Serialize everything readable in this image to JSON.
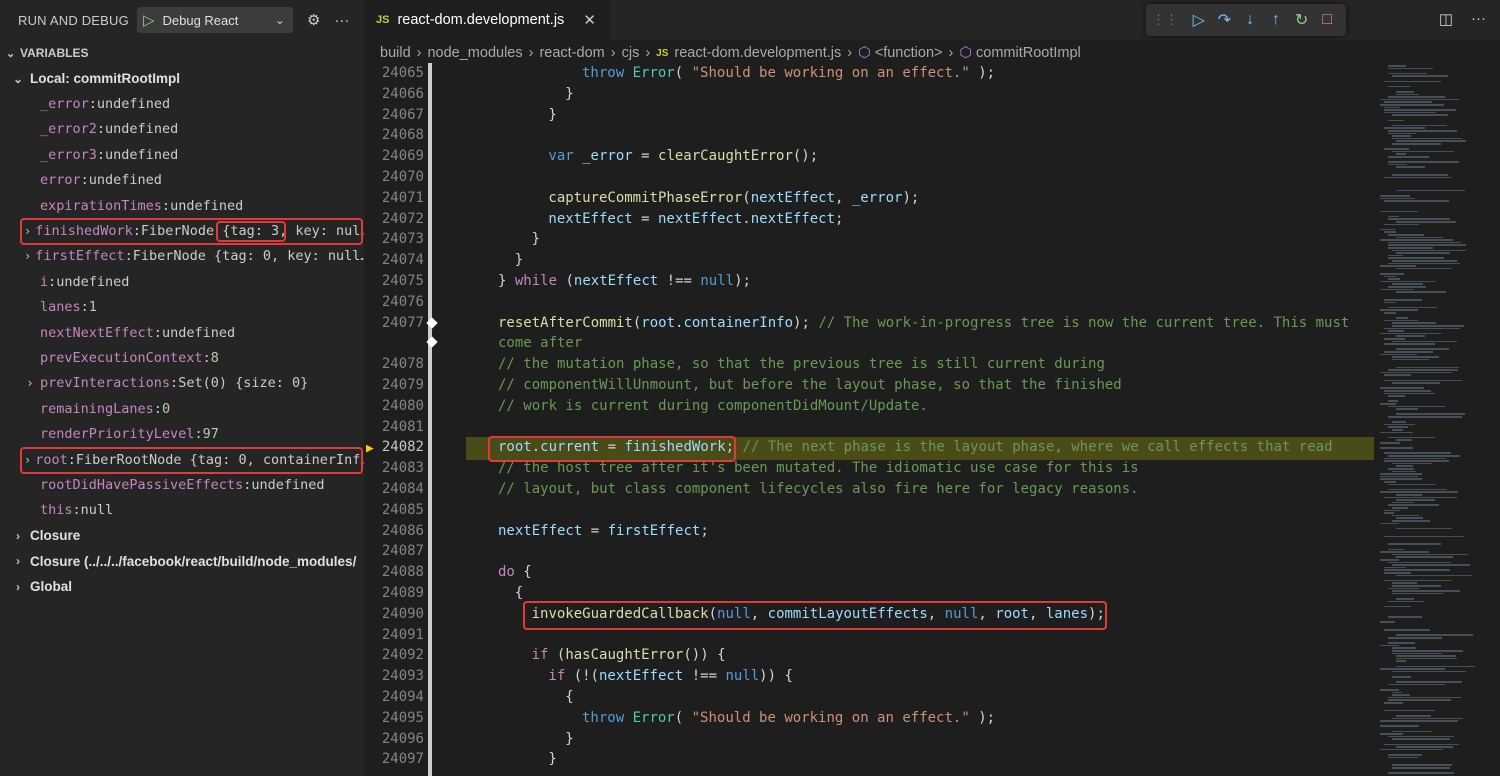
{
  "sidebar": {
    "title": "RUN AND DEBUG",
    "config_label": "Debug React",
    "variables_header": "VARIABLES",
    "local_scope": "Local: commitRootImpl",
    "variables": [
      {
        "name": "_error",
        "value": "undefined",
        "expandable": false
      },
      {
        "name": "_error2",
        "value": "undefined",
        "expandable": false
      },
      {
        "name": "_error3",
        "value": "undefined",
        "expandable": false
      },
      {
        "name": "error",
        "value": "undefined",
        "expandable": false
      },
      {
        "name": "expirationTimes",
        "value": "undefined",
        "expandable": false
      },
      {
        "name": "finishedWork",
        "value": "FiberNode {tag: 3, key: nul…",
        "expandable": true
      },
      {
        "name": "firstEffect",
        "value": "FiberNode {tag: 0, key: null…",
        "expandable": true
      },
      {
        "name": "i",
        "value": "undefined",
        "expandable": false
      },
      {
        "name": "lanes",
        "value": "1",
        "expandable": false
      },
      {
        "name": "nextNextEffect",
        "value": "undefined",
        "expandable": false
      },
      {
        "name": "prevExecutionContext",
        "value": "8",
        "expandable": false
      },
      {
        "name": "prevInteractions",
        "value": "Set(0) {size: 0}",
        "expandable": true
      },
      {
        "name": "remainingLanes",
        "value": "0",
        "expandable": false
      },
      {
        "name": "renderPriorityLevel",
        "value": "97",
        "expandable": false
      },
      {
        "name": "root",
        "value": "FiberRootNode {tag: 0, containerInf…",
        "expandable": true
      },
      {
        "name": "rootDidHavePassiveEffects",
        "value": "undefined",
        "expandable": false
      },
      {
        "name": "this",
        "value": "null",
        "expandable": false
      }
    ],
    "scopes": [
      "Closure",
      "Closure (../../../facebook/react/build/node_modules/",
      "Global"
    ]
  },
  "editor": {
    "tab_icon": "JS",
    "tab_name": "react-dom.development.js",
    "breadcrumb": [
      "build",
      "node_modules",
      "react-dom",
      "cjs",
      "react-dom.development.js",
      "<function>",
      "commitRootImpl"
    ],
    "current_line": "24082",
    "lines": [
      {
        "n": "24065",
        "text": "          throw Error( \"Should be working on an effect.\" );"
      },
      {
        "n": "24066",
        "text": "        }"
      },
      {
        "n": "24067",
        "text": "      }"
      },
      {
        "n": "24068",
        "text": ""
      },
      {
        "n": "24069",
        "text": "      var _error = clearCaughtError();"
      },
      {
        "n": "24070",
        "text": ""
      },
      {
        "n": "24071",
        "text": "      captureCommitPhaseError(nextEffect, _error);"
      },
      {
        "n": "24072",
        "text": "      nextEffect = nextEffect.nextEffect;"
      },
      {
        "n": "24073",
        "text": "    }"
      },
      {
        "n": "24074",
        "text": "  }"
      },
      {
        "n": "24075",
        "text": "} while (nextEffect !== null);"
      },
      {
        "n": "24076",
        "text": ""
      },
      {
        "n": "24077",
        "text": "resetAfterCommit(root.containerInfo); // The work-in-progress tree is now the current tree. This must"
      },
      {
        "n": "",
        "text": "come after"
      },
      {
        "n": "24078",
        "text": "// the mutation phase, so that the previous tree is still current during"
      },
      {
        "n": "24079",
        "text": "// componentWillUnmount, but before the layout phase, so that the finished"
      },
      {
        "n": "24080",
        "text": "// work is current during componentDidMount/Update."
      },
      {
        "n": "24081",
        "text": ""
      },
      {
        "n": "24082",
        "text": "root.current = finishedWork; // The next phase is the layout phase, where we call effects that read"
      },
      {
        "n": "24083",
        "text": "// the host tree after it's been mutated. The idiomatic use case for this is"
      },
      {
        "n": "24084",
        "text": "// layout, but class component lifecycles also fire here for legacy reasons."
      },
      {
        "n": "24085",
        "text": ""
      },
      {
        "n": "24086",
        "text": "nextEffect = firstEffect;"
      },
      {
        "n": "24087",
        "text": ""
      },
      {
        "n": "24088",
        "text": "do {"
      },
      {
        "n": "24089",
        "text": "  {"
      },
      {
        "n": "24090",
        "text": "    invokeGuardedCallback(null, commitLayoutEffects, null, root, lanes);"
      },
      {
        "n": "24091",
        "text": ""
      },
      {
        "n": "24092",
        "text": "    if (hasCaughtError()) {"
      },
      {
        "n": "24093",
        "text": "      if (!(nextEffect !== null)) {"
      },
      {
        "n": "24094",
        "text": "        {"
      },
      {
        "n": "24095",
        "text": "          throw Error( \"Should be working on an effect.\" );"
      },
      {
        "n": "24096",
        "text": "        }"
      },
      {
        "n": "24097",
        "text": "      }"
      }
    ]
  },
  "colors": {
    "highlight_box": "#e03a3a",
    "current_line_bg": "#4b4b18",
    "exec_arrow": "#ffcc00"
  }
}
